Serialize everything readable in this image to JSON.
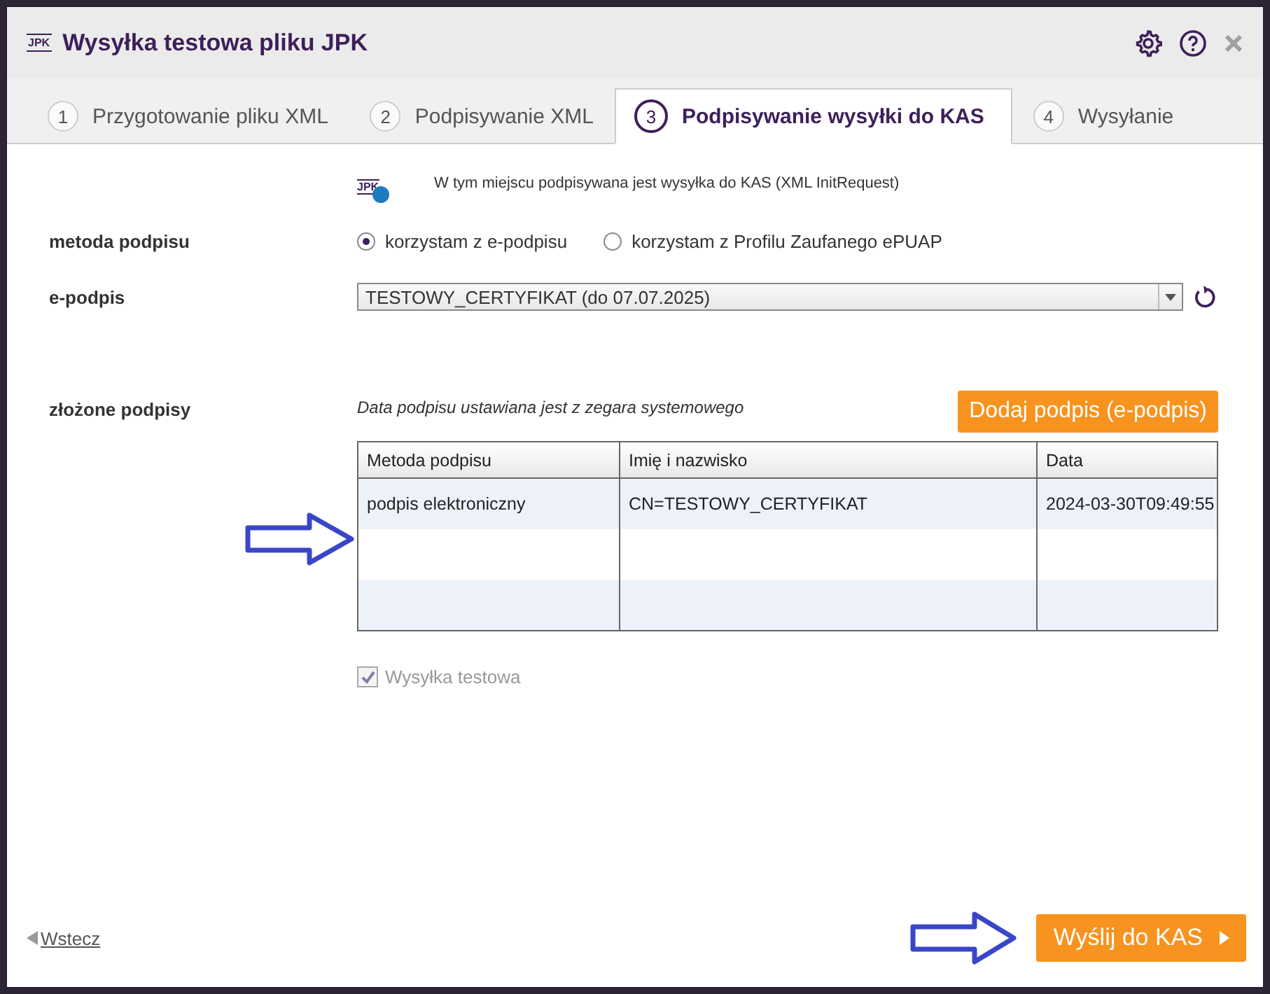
{
  "window": {
    "logo": "JPK",
    "title": "Wysyłka testowa pliku JPK"
  },
  "tabs": [
    {
      "number": "1",
      "label": "Przygotowanie pliku XML",
      "selected": false
    },
    {
      "number": "2",
      "label": "Podpisywanie XML",
      "selected": false
    },
    {
      "number": "3",
      "label": "Podpisywanie wysyłki do KAS",
      "selected": true
    },
    {
      "number": "4",
      "label": "Wysyłanie",
      "selected": false
    }
  ],
  "info": {
    "logo": "JPK",
    "text": "W tym miejscu podpisywana jest wysyłka do KAS (XML InitRequest)"
  },
  "method": {
    "label": "metoda podpisu",
    "options": [
      {
        "label": "korzystam z e-podpisu",
        "selected": true
      },
      {
        "label": "korzystam z Profilu Zaufanego ePUAP",
        "selected": false
      }
    ]
  },
  "signature": {
    "label": "e-podpis",
    "value": "TESTOWY_CERTYFIKAT (do 07.07.2025)"
  },
  "signatures": {
    "label": "złożone podpisy",
    "note": "Data podpisu ustawiana jest z zegara systemowego",
    "add_button": "Dodaj podpis (e-podpis)",
    "columns": [
      "Metoda podpisu",
      "Imię i nazwisko",
      "Data"
    ],
    "rows": [
      [
        "podpis elektroniczny",
        "CN=TESTOWY_CERTYFIKAT",
        "2024-03-30T09:49:55"
      ]
    ]
  },
  "test_send": {
    "label": "Wysyłka testowa",
    "checked": true,
    "disabled": true
  },
  "footer": {
    "back": "Wstecz",
    "next": "Wyślij do KAS"
  }
}
